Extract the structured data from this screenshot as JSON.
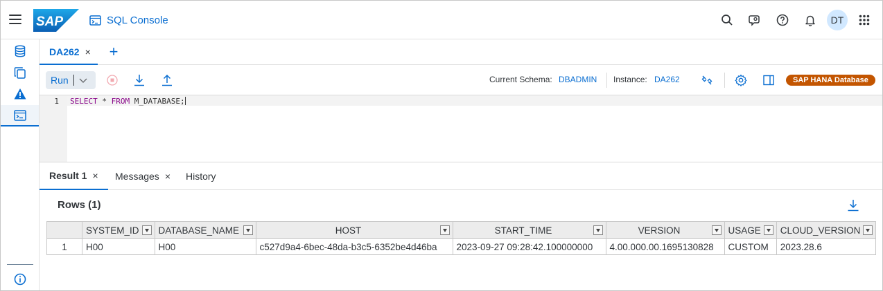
{
  "shell": {
    "app_title": "SQL Console",
    "avatar_initials": "DT",
    "logo_text": "SAP"
  },
  "editor_tabs": [
    {
      "label": "DA262",
      "close": "×"
    }
  ],
  "add_tab_label": "+",
  "toolbar": {
    "run_label": "Run",
    "schema_label": "Current Schema:",
    "schema_value": "DBADMIN",
    "instance_label": "Instance:",
    "instance_value": "DA262",
    "db_badge": "SAP HANA Database"
  },
  "editor": {
    "line_number": "1",
    "keyword_select": "SELECT",
    "star": " * ",
    "keyword_from": "FROM",
    "rest": " M_DATABASE;"
  },
  "result_tabs": [
    {
      "label": "Result 1",
      "close": "×"
    },
    {
      "label": "Messages",
      "close": "×"
    },
    {
      "label": "History"
    }
  ],
  "result": {
    "rows_title": "Rows (1)",
    "columns": [
      "SYSTEM_ID",
      "DATABASE_NAME",
      "HOST",
      "START_TIME",
      "VERSION",
      "USAGE",
      "CLOUD_VERSION"
    ],
    "rows": [
      [
        "1",
        "H00",
        "H00",
        "c527d9a4-6bec-48da-b3c5-6352be4d46ba",
        "2023-09-27 09:28:42.100000000",
        "4.00.000.00.1695130828",
        "CUSTOM",
        "2023.28.6"
      ]
    ]
  },
  "colors": {
    "accent": "#0a6ed1",
    "badge": "#c35500",
    "keyword": "#8b0a8b"
  },
  "icons": {
    "shell": [
      "menu-icon",
      "sap-logo",
      "console-icon",
      "search-icon",
      "feedback-icon",
      "help-icon",
      "notifications-icon",
      "app-grid-icon"
    ],
    "nav": [
      "database-icon",
      "copy-icon",
      "alert-icon",
      "sql-console-icon",
      "info-icon"
    ],
    "toolbar": [
      "chevron-down-icon",
      "stop-icon",
      "download-icon",
      "upload-icon",
      "connect-icon",
      "settings-icon",
      "side-panel-icon"
    ]
  }
}
